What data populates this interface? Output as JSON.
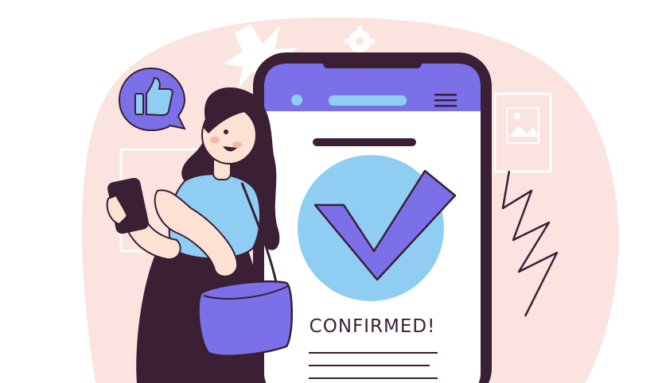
{
  "status": {
    "text": "CONFIRMED!"
  },
  "colors": {
    "background_blob": "#fbe3df",
    "ink": "#3a1f35",
    "accent_purple": "#7b70e8",
    "accent_blue": "#8fcdf2",
    "skin": "#fde2d4",
    "white": "#ffffff"
  },
  "icons": [
    "thumbs-up-icon",
    "checkmark-icon",
    "gear-icon",
    "picture-frame-icon",
    "hamburger-menu-icon"
  ]
}
